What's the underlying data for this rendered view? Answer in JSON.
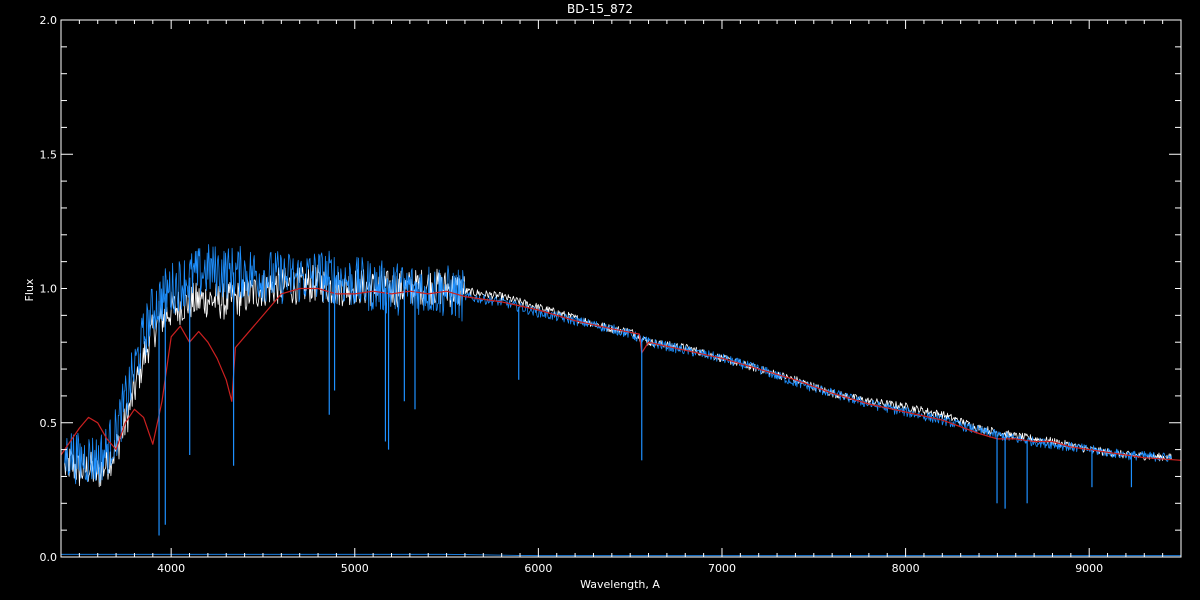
{
  "chart_data": {
    "type": "line",
    "title": "BD-15_872",
    "xlabel": "Wavelength, A",
    "ylabel": "Flux",
    "xlim": [
      3400,
      9500
    ],
    "ylim": [
      0.0,
      2.0
    ],
    "x_ticks": [
      4000,
      5000,
      6000,
      7000,
      8000,
      9000
    ],
    "y_ticks": [
      0.0,
      0.5,
      1.0,
      1.5,
      2.0
    ],
    "y_tick_labels": [
      "0.0",
      "0.5",
      "1.0",
      "1.5",
      "2.0"
    ],
    "grid": false,
    "colors": {
      "background": "#000000",
      "axes": "#ffffff",
      "white": "#ffffff",
      "blue": "#1e90ff",
      "red": "#cc2020"
    },
    "series": [
      {
        "color": "#ffffff",
        "x": [
          3420,
          3450,
          3500,
          3550,
          3600,
          3650,
          3700,
          3750,
          3800,
          3850,
          3900,
          3950,
          4000,
          4100,
          4200,
          4300,
          4400,
          4500,
          4600,
          4700,
          4800,
          4900,
          5000,
          5100,
          5200,
          5300,
          5400,
          5500,
          5600,
          5700,
          5800,
          5900,
          6000,
          6200,
          6400,
          6500,
          6600,
          6800,
          7000,
          7200,
          7400,
          7600,
          7800,
          8000,
          8200,
          8400,
          8600,
          8800,
          9000,
          9200,
          9450
        ],
        "y": [
          0.33,
          0.35,
          0.32,
          0.33,
          0.31,
          0.35,
          0.4,
          0.5,
          0.62,
          0.74,
          0.84,
          0.89,
          0.92,
          0.95,
          0.96,
          0.95,
          0.97,
          1.0,
          1.01,
          1.01,
          1.02,
          1.0,
          1.01,
          1.0,
          1.0,
          1.0,
          1.01,
          1.0,
          0.99,
          0.98,
          0.97,
          0.95,
          0.93,
          0.89,
          0.85,
          0.84,
          0.8,
          0.78,
          0.74,
          0.7,
          0.66,
          0.61,
          0.58,
          0.56,
          0.53,
          0.48,
          0.45,
          0.43,
          0.4,
          0.38,
          0.37
        ]
      },
      {
        "color": "#1e90ff",
        "x": [
          3420,
          3450,
          3500,
          3550,
          3600,
          3650,
          3700,
          3750,
          3800,
          3850,
          3900,
          3950,
          4000,
          4100,
          4200,
          4300,
          4400,
          4500,
          4600,
          4700,
          4800,
          4900,
          5000,
          5100,
          5200,
          5300,
          5400,
          5500,
          5600,
          5700,
          5800,
          5900,
          6000,
          6200,
          6400,
          6500,
          6600,
          6800,
          7000,
          7200,
          7400,
          7600,
          7800,
          8000,
          8200,
          8400,
          8600,
          8800,
          9000,
          9200,
          9450
        ],
        "y": [
          0.37,
          0.39,
          0.36,
          0.37,
          0.36,
          0.4,
          0.46,
          0.58,
          0.7,
          0.82,
          0.92,
          0.97,
          1.0,
          1.04,
          1.07,
          1.06,
          1.06,
          1.05,
          1.04,
          1.04,
          1.05,
          1.04,
          1.02,
          1.01,
          1.0,
          1.0,
          1.0,
          0.99,
          0.97,
          0.96,
          0.95,
          0.93,
          0.91,
          0.88,
          0.85,
          0.83,
          0.8,
          0.77,
          0.74,
          0.7,
          0.65,
          0.61,
          0.57,
          0.54,
          0.51,
          0.47,
          0.44,
          0.42,
          0.4,
          0.38,
          0.37
        ]
      },
      {
        "color": "#cc2020",
        "x": [
          3400,
          3450,
          3500,
          3550,
          3600,
          3650,
          3700,
          3750,
          3800,
          3850,
          3900,
          3950,
          4000,
          4050,
          4100,
          4150,
          4200,
          4250,
          4300,
          4330,
          4350,
          4400,
          4500,
          4600,
          4700,
          4800,
          4900,
          5000,
          5100,
          5200,
          5300,
          5400,
          5500,
          5600,
          5800,
          6000,
          6200,
          6400,
          6550,
          6563,
          6600,
          6800,
          7000,
          7200,
          7400,
          7600,
          7800,
          8000,
          8200,
          8400,
          8500,
          8600,
          8700,
          8800,
          8900,
          9000,
          9100,
          9200,
          9300,
          9500
        ],
        "y": [
          0.38,
          0.43,
          0.48,
          0.52,
          0.5,
          0.44,
          0.4,
          0.5,
          0.55,
          0.52,
          0.42,
          0.58,
          0.82,
          0.86,
          0.8,
          0.84,
          0.8,
          0.74,
          0.66,
          0.58,
          0.78,
          0.82,
          0.9,
          0.98,
          1.0,
          1.0,
          0.98,
          0.98,
          0.99,
          0.98,
          0.99,
          0.98,
          0.99,
          0.97,
          0.95,
          0.92,
          0.88,
          0.85,
          0.83,
          0.76,
          0.8,
          0.77,
          0.74,
          0.7,
          0.66,
          0.61,
          0.57,
          0.54,
          0.51,
          0.46,
          0.44,
          0.44,
          0.43,
          0.43,
          0.41,
          0.4,
          0.39,
          0.38,
          0.37,
          0.36
        ]
      },
      {
        "color": "#1e90ff",
        "x": [
          3400,
          4000,
          5000,
          5500,
          6000,
          7000,
          8000,
          9000,
          9500
        ],
        "y": [
          0.01,
          0.01,
          0.01,
          0.01,
          0.005,
          0.005,
          0.005,
          0.005,
          0.005
        ]
      }
    ],
    "absorption_lines": [
      {
        "x": 3934,
        "y": 0.08
      },
      {
        "x": 3968,
        "y": 0.12
      },
      {
        "x": 4101,
        "y": 0.38
      },
      {
        "x": 4340,
        "y": 0.34
      },
      {
        "x": 4861,
        "y": 0.53
      },
      {
        "x": 4890,
        "y": 0.62
      },
      {
        "x": 5167,
        "y": 0.43
      },
      {
        "x": 5184,
        "y": 0.4
      },
      {
        "x": 5270,
        "y": 0.58
      },
      {
        "x": 5328,
        "y": 0.55
      },
      {
        "x": 5893,
        "y": 0.66
      },
      {
        "x": 6563,
        "y": 0.36
      },
      {
        "x": 8498,
        "y": 0.2
      },
      {
        "x": 8542,
        "y": 0.18
      },
      {
        "x": 8662,
        "y": 0.2
      },
      {
        "x": 9015,
        "y": 0.26
      },
      {
        "x": 9230,
        "y": 0.26
      }
    ]
  }
}
